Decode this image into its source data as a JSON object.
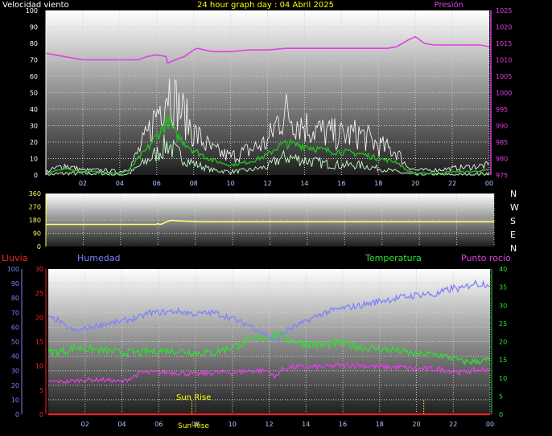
{
  "title": "24 hour graph day : 04 Abril 2025",
  "colors": {
    "wind_axis": "#ffffff",
    "pressure": "#e040e0",
    "direction_axis": "#ffff60",
    "rain": "#ff2020",
    "humidity": "#8080ff",
    "temperature": "#30e030",
    "dewpoint": "#e040e0",
    "wind_gust": "#f0f0f0",
    "wind_avg": "#20c020",
    "wind_low": "#c8ffc8",
    "sun": "#ffff00"
  },
  "chart_data": [
    {
      "type": "line",
      "x_ticks": [
        "02",
        "04",
        "06",
        "08",
        "10",
        "12",
        "14",
        "16",
        "18",
        "20",
        "22",
        "00"
      ],
      "ylabel_left": "Velocidad viento",
      "ylabel_right": "Presión",
      "left_ticks": [
        0,
        10,
        20,
        30,
        40,
        50,
        60,
        70,
        80,
        90,
        100
      ],
      "right_ticks": [
        975,
        980,
        985,
        990,
        995,
        1000,
        1005,
        1010,
        1015,
        1020,
        1025
      ],
      "ylim_left": [
        0,
        100
      ],
      "ylim_right": [
        975,
        1025
      ],
      "grid": true,
      "series": [
        {
          "axis": "right",
          "x": [
            0,
            1,
            2,
            3,
            4,
            5,
            5.5,
            6,
            6.5,
            6.6,
            7,
            7.5,
            8,
            8.2,
            9,
            10,
            11,
            12,
            13,
            14,
            15,
            16,
            17,
            18,
            18.5,
            19,
            19.3,
            19.6,
            20,
            20.5,
            21,
            22,
            23,
            23.5,
            24
          ],
          "values": [
            1012,
            1011,
            1010,
            1010,
            1010,
            1010,
            1011,
            1011.5,
            1011,
            1009,
            1010,
            1011,
            1013,
            1013.5,
            1012.5,
            1012.5,
            1013,
            1013,
            1013.5,
            1013.5,
            1013.5,
            1013.5,
            1013.5,
            1013.5,
            1013.5,
            1014,
            1015,
            1016,
            1017,
            1015,
            1014.5,
            1014.5,
            1014.5,
            1014.5,
            1014
          ]
        },
        {
          "axis": "left",
          "x": [
            0,
            1,
            2,
            3,
            4,
            4.5,
            5,
            5.5,
            6,
            6.3,
            6.6,
            7,
            7.5,
            8,
            9,
            10,
            11,
            12,
            12.5,
            13,
            14,
            15,
            16,
            17,
            18,
            19,
            19.5,
            20,
            21,
            22,
            23,
            24
          ],
          "values": [
            2,
            6,
            3,
            3,
            2,
            4,
            14,
            24,
            38,
            45,
            55,
            45,
            36,
            26,
            15,
            11,
            15,
            20,
            32,
            38,
            30,
            26,
            24,
            25,
            18,
            14,
            6,
            3,
            3,
            4,
            5,
            6
          ]
        },
        {
          "axis": "left",
          "x": [
            0,
            1,
            2,
            3,
            4,
            4.5,
            5,
            5.5,
            6,
            6.3,
            6.6,
            7,
            7.5,
            8,
            9,
            10,
            11,
            12,
            12.5,
            13,
            14,
            15,
            16,
            17,
            18,
            19,
            19.5,
            20,
            21,
            22,
            23,
            24
          ],
          "values": [
            1,
            4,
            2,
            2,
            1,
            3,
            10,
            16,
            24,
            28,
            33,
            25,
            20,
            15,
            9,
            6,
            8,
            12,
            17,
            19,
            18,
            15,
            14,
            13,
            10,
            8,
            3,
            1,
            1,
            2,
            2,
            3
          ]
        },
        {
          "axis": "left",
          "x": [
            0,
            1,
            2,
            3,
            4,
            4.5,
            5,
            5.5,
            6,
            6.3,
            6.6,
            7,
            7.5,
            8,
            9,
            10,
            11,
            12,
            12.5,
            13,
            14,
            15,
            16,
            17,
            18,
            19,
            19.5,
            20,
            21,
            22,
            23,
            24
          ],
          "values": [
            0,
            1,
            1,
            1,
            0,
            1,
            5,
            9,
            13,
            16,
            19,
            14,
            10,
            7,
            3,
            2,
            3,
            5,
            9,
            11,
            9,
            7,
            6,
            6,
            4,
            2,
            1,
            0,
            0,
            0,
            0,
            1
          ]
        }
      ]
    },
    {
      "type": "line",
      "left_ticks": [
        0,
        90,
        180,
        270,
        360
      ],
      "ylim_left": [
        0,
        360
      ],
      "compass_labels": [
        "N",
        "W",
        "S",
        "E",
        "N"
      ],
      "grid": true,
      "series": [
        {
          "x": [
            0,
            5.9,
            6,
            6.1,
            6.2,
            6.6,
            6.8,
            7,
            7.5,
            8,
            8.5,
            9,
            24
          ],
          "values": [
            150,
            150,
            155,
            150,
            152,
            175,
            177,
            175,
            172,
            170,
            168,
            168,
            168
          ]
        }
      ]
    },
    {
      "type": "line",
      "ylabel_left": "Lluvia",
      "ylabel_left_inner": "Humedad",
      "ylabel_right_inner": "Temperatura",
      "ylabel_right": "Punto rocío",
      "x_ticks": [
        "02",
        "04",
        "06",
        "08",
        "10",
        "12",
        "14",
        "16",
        "18",
        "20",
        "22",
        "00"
      ],
      "rain_ticks": [
        0,
        5,
        10,
        15,
        20,
        25,
        30
      ],
      "humidity_ticks": [
        0,
        10,
        20,
        30,
        40,
        50,
        60,
        70,
        80,
        90,
        100
      ],
      "temp_ticks": [
        0,
        5,
        10,
        15,
        20,
        25,
        30,
        35,
        40
      ],
      "ylim_rain": [
        0,
        30
      ],
      "ylim_humidity": [
        0,
        100
      ],
      "ylim_temp": [
        0,
        40
      ],
      "annotation": "Sun Rise",
      "grid": true,
      "series": [
        {
          "axis": "rain",
          "x": [
            0,
            24
          ],
          "values": [
            0,
            0
          ]
        },
        {
          "axis": "humidity",
          "x": [
            0,
            0.5,
            1,
            1.5,
            2,
            3,
            4,
            5,
            5.5,
            6,
            7,
            8,
            9,
            10,
            10.5,
            11,
            11.5,
            12,
            12.3,
            12.6,
            13,
            14,
            15,
            16,
            17,
            18,
            19,
            20,
            20.5,
            21,
            22,
            22.5,
            23,
            23.5,
            24
          ],
          "values": [
            66,
            65,
            60,
            57,
            59,
            62,
            64,
            67,
            70,
            70,
            71,
            69,
            70,
            66,
            63,
            61,
            57,
            54,
            50,
            54,
            58,
            64,
            70,
            73,
            75,
            78,
            80,
            82,
            83,
            82,
            87,
            86,
            90,
            90,
            90
          ]
        },
        {
          "axis": "temp",
          "x": [
            0,
            1,
            1.5,
            2,
            3,
            4,
            5,
            6,
            7,
            8,
            9,
            10,
            11,
            12,
            12.5,
            13,
            14,
            15,
            16,
            17,
            18,
            19,
            20,
            21,
            22,
            22.5,
            23,
            24
          ],
          "values": [
            17,
            17.5,
            18.5,
            18,
            17.5,
            17,
            17,
            17.5,
            17.5,
            17,
            17,
            18.5,
            20.5,
            21.5,
            22,
            20.5,
            19.5,
            19,
            19.5,
            18.5,
            18,
            17.5,
            16.5,
            16.5,
            15.5,
            14.5,
            14.5,
            15
          ]
        },
        {
          "axis": "temp",
          "x": [
            0,
            1,
            2,
            3,
            4,
            4.5,
            5,
            6,
            7,
            8,
            9,
            10,
            11,
            12,
            12.3,
            12.6,
            13,
            14,
            15,
            16,
            17,
            18,
            19,
            20,
            21,
            22,
            22.5,
            23,
            24
          ],
          "values": [
            9,
            9,
            9.5,
            9.5,
            9,
            10,
            11.5,
            11.5,
            11.5,
            11,
            11.5,
            11.5,
            12,
            12,
            10,
            12,
            13,
            13,
            13,
            13.5,
            13.5,
            13,
            13,
            12.5,
            12.5,
            12,
            11.5,
            12,
            12.5
          ]
        }
      ]
    }
  ]
}
